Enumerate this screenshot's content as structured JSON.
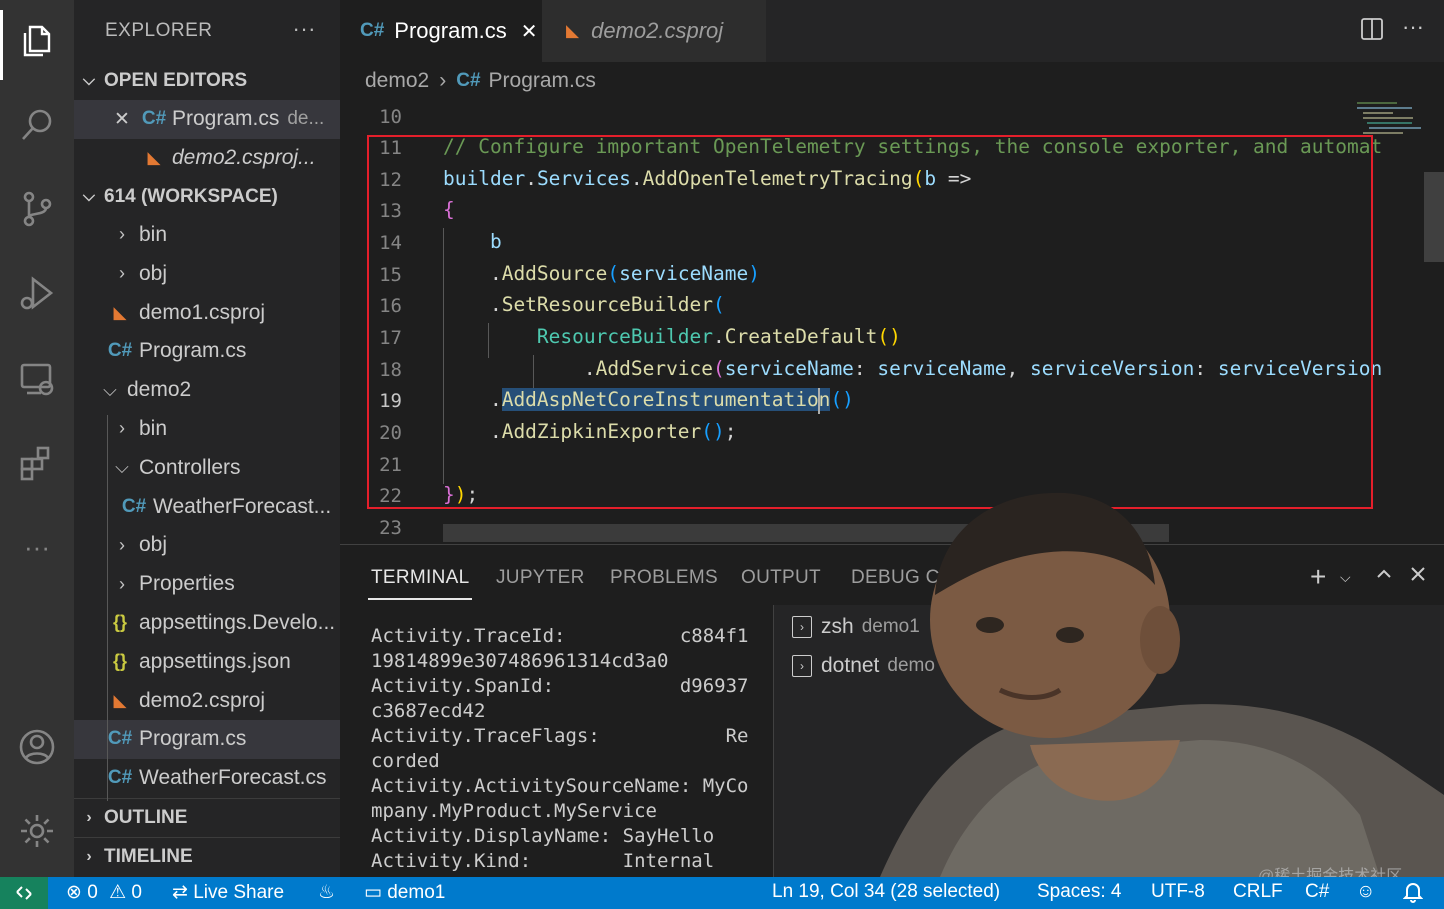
{
  "explorer": {
    "title": "EXPLORER",
    "more": "···",
    "open_editors": {
      "title": "OPEN EDITORS",
      "items": [
        {
          "label": "Program.cs",
          "desc": "de...",
          "close": "✕"
        },
        {
          "label": "demo2.csproj..."
        }
      ]
    },
    "workspace": {
      "title": "614 (WORKSPACE)",
      "items": [
        {
          "label": "bin"
        },
        {
          "label": "obj"
        },
        {
          "label": "demo1.csproj"
        },
        {
          "label": "Program.cs"
        },
        {
          "label": "demo2"
        },
        {
          "label": "bin"
        },
        {
          "label": "Controllers"
        },
        {
          "label": "WeatherForecast..."
        },
        {
          "label": "obj"
        },
        {
          "label": "Properties"
        },
        {
          "label": "appsettings.Develo..."
        },
        {
          "label": "appsettings.json"
        },
        {
          "label": "demo2.csproj"
        },
        {
          "label": "Program.cs"
        },
        {
          "label": "WeatherForecast.cs"
        }
      ]
    },
    "outline": "OUTLINE",
    "timeline": "TIMELINE"
  },
  "tabs": [
    {
      "label": "Program.cs",
      "close": "✕"
    },
    {
      "label": "demo2.csproj"
    }
  ],
  "breadcrumb": {
    "folder": "demo2",
    "sep": "›",
    "file": "Program.cs"
  },
  "editor": {
    "line_numbers": [
      "10",
      "11",
      "12",
      "13",
      "14",
      "15",
      "16",
      "17",
      "18",
      "19",
      "20",
      "21",
      "22",
      "23"
    ],
    "current_line": "19"
  },
  "panel": {
    "tabs": [
      "TERMINAL",
      "JUPYTER",
      "PROBLEMS",
      "OUTPUT",
      "DEBUG C"
    ],
    "terminal_lines": [
      "Activity.TraceId:          c884f1",
      "19814899e307486961314cd3a0",
      "Activity.SpanId:           d96937",
      "c3687ecd42",
      "Activity.TraceFlags:           Re",
      "corded",
      "Activity.ActivitySourceName: MyCo",
      "mpany.MyProduct.MyService",
      "Activity.DisplayName: SayHello",
      "Activity.Kind:        Internal"
    ],
    "terminals": [
      {
        "shell": "zsh",
        "name": "demo1"
      },
      {
        "shell": "dotnet",
        "name": "demo"
      }
    ]
  },
  "status": {
    "errors": "0",
    "warnings": "0",
    "live_share": "Live Share",
    "folder": "demo1",
    "position": "Ln 19, Col 34 (28 selected)",
    "spaces": "Spaces: 4",
    "encoding": "UTF-8",
    "eol": "CRLF",
    "language": "C#"
  },
  "watermark": "@稀土掘金技术社区",
  "colors": {
    "accent": "#007acc",
    "highlight_box": "#e51f2b",
    "comment": "#6a9955"
  }
}
